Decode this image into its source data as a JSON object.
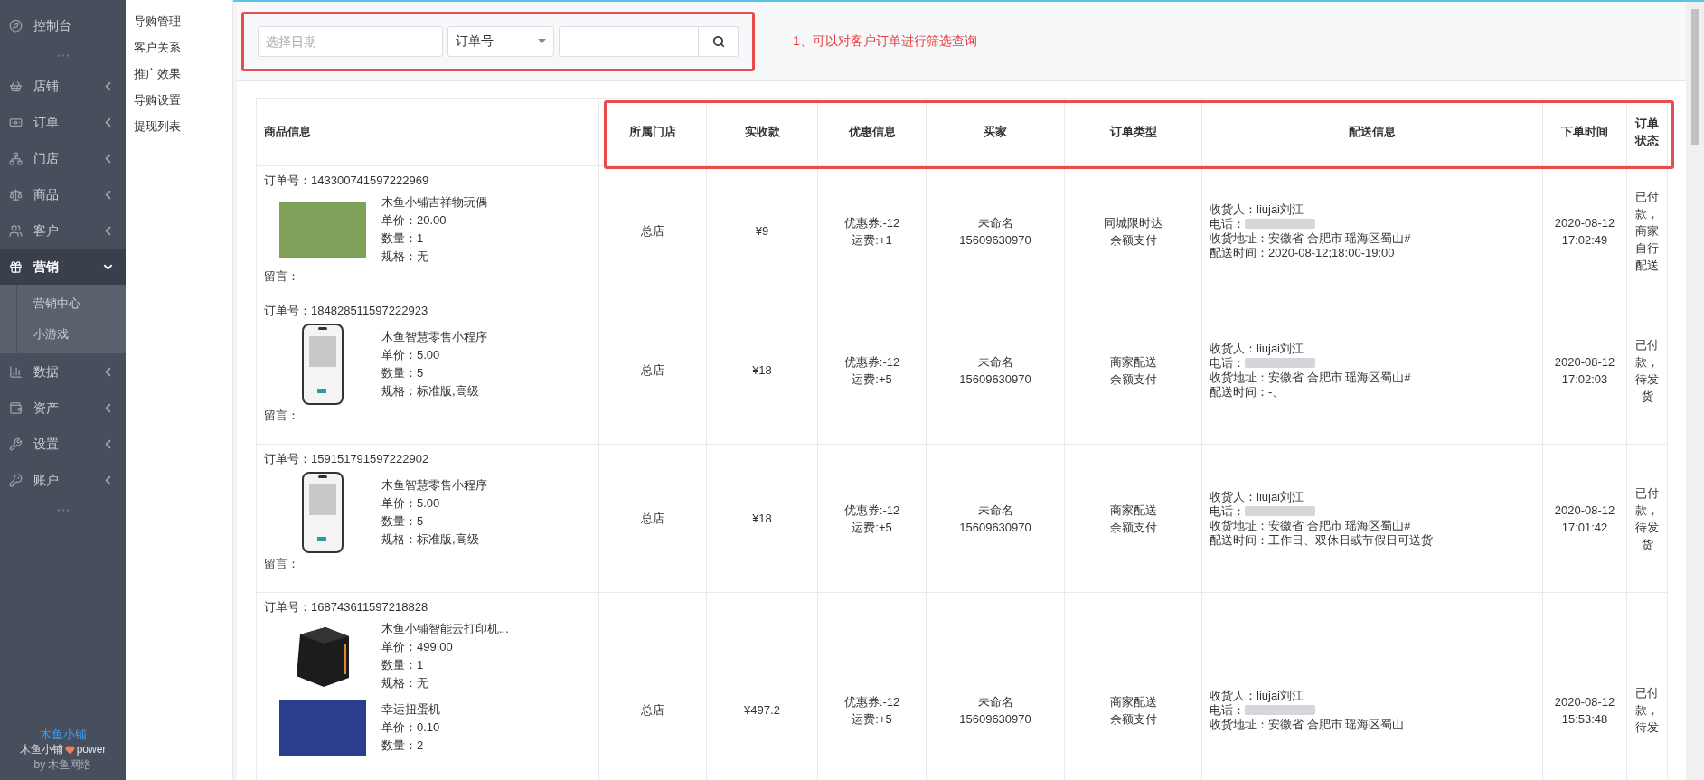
{
  "sidebar": {
    "items": [
      {
        "kind": "plain",
        "label": "控制台",
        "selected": false
      },
      {
        "kind": "separator"
      },
      {
        "kind": "group",
        "label": "店铺",
        "selected": false,
        "expanded": false
      },
      {
        "kind": "group",
        "label": "订单",
        "selected": false,
        "expanded": false
      },
      {
        "kind": "group",
        "label": "门店",
        "selected": false,
        "expanded": false
      },
      {
        "kind": "group",
        "label": "商品",
        "selected": false,
        "expanded": false
      },
      {
        "kind": "group",
        "label": "客户",
        "selected": false,
        "expanded": false
      },
      {
        "kind": "group",
        "label": "营销",
        "selected": true,
        "expanded": true,
        "children": [
          {
            "label": "营销中心",
            "selected": false
          },
          {
            "label": "小游戏",
            "selected": false
          }
        ]
      },
      {
        "kind": "group",
        "label": "数据",
        "selected": false,
        "expanded": false
      },
      {
        "kind": "group",
        "label": "资产",
        "selected": false,
        "expanded": false
      },
      {
        "kind": "group",
        "label": "设置",
        "selected": false,
        "expanded": false
      },
      {
        "kind": "group",
        "label": "账户",
        "selected": false,
        "expanded": false
      },
      {
        "kind": "separator"
      }
    ],
    "footer": {
      "brand": "木鱼小铺",
      "credit_prefix": "木鱼小铺",
      "credit_suffix": "power",
      "byline": "by 木鱼网络"
    }
  },
  "subnav": {
    "items": [
      {
        "label": "导购管理",
        "selected": false
      },
      {
        "label": "客户关系",
        "selected": false
      },
      {
        "label": "推广效果",
        "selected": false
      },
      {
        "label": "导购设置",
        "selected": false
      },
      {
        "label": "提现列表",
        "selected": false
      }
    ]
  },
  "filter": {
    "date": {
      "placeholder": "选择日期"
    },
    "field_select": {
      "value": "订单号"
    },
    "annotation": "1、可以对客户订单进行筛选查询"
  },
  "table": {
    "columns": [
      "商品信息",
      "所属门店",
      "实收款",
      "优惠信息",
      "买家",
      "订单类型",
      "配送信息",
      "下单时间",
      "订单状态"
    ],
    "rows": [
      {
        "order_no": "订单号：143300741597222969",
        "products": [
          {
            "kind": "photo",
            "name": "木鱼小铺吉祥物玩偶",
            "lines": [
              "单价：20.00",
              "数量：1",
              "规格：无"
            ]
          }
        ],
        "note": "留言：",
        "store": "总店",
        "amount": "¥9",
        "discount": [
          "优惠券:-12",
          "运费:+1"
        ],
        "buyer": [
          "未命名",
          "15609630970"
        ],
        "order_type": [
          "同城限时达",
          "余额支付"
        ],
        "delivery": {
          "recipient": "收货人：liujai刘江",
          "phone": "电话：",
          "address": "收货地址：安徽省 合肥市 瑶海区蜀山#",
          "time": "配送时间：2020-08-12;18:00-19:00"
        },
        "created": [
          "2020-08-12",
          "17:02:49"
        ],
        "status": "已付款，商家自行配送"
      },
      {
        "order_no": "订单号：184828511597222923",
        "products": [
          {
            "kind": "phone",
            "name": "木鱼智慧零售小程序",
            "lines": [
              "单价：5.00",
              "数量：5",
              "规格：标准版,高级"
            ]
          }
        ],
        "note": "留言：",
        "store": "总店",
        "amount": "¥18",
        "discount": [
          "优惠券:-12",
          "运费:+5"
        ],
        "buyer": [
          "未命名",
          "15609630970"
        ],
        "order_type": [
          "商家配送",
          "余额支付"
        ],
        "delivery": {
          "recipient": "收货人：liujai刘江",
          "phone": "电话：",
          "address": "收货地址：安徽省 合肥市 瑶海区蜀山#",
          "time": "配送时间：-、"
        },
        "created": [
          "2020-08-12",
          "17:02:03"
        ],
        "status": "已付款，待发货"
      },
      {
        "order_no": "订单号：159151791597222902",
        "products": [
          {
            "kind": "phone",
            "name": "木鱼智慧零售小程序",
            "lines": [
              "单价：5.00",
              "数量：5",
              "规格：标准版,高级"
            ]
          }
        ],
        "note": "留言：",
        "store": "总店",
        "amount": "¥18",
        "discount": [
          "优惠券:-12",
          "运费:+5"
        ],
        "buyer": [
          "未命名",
          "15609630970"
        ],
        "order_type": [
          "商家配送",
          "余额支付"
        ],
        "delivery": {
          "recipient": "收货人：liujai刘江",
          "phone": "电话：",
          "address": "收货地址：安徽省 合肥市 瑶海区蜀山#",
          "time": "配送时间：工作日、双休日或节假日可送货"
        },
        "created": [
          "2020-08-12",
          "17:01:42"
        ],
        "status": "已付款，待发货"
      },
      {
        "order_no": "订单号：168743611597218828",
        "products": [
          {
            "kind": "printer",
            "name": "木鱼小铺智能云打印机...",
            "lines": [
              "单价：499.00",
              "数量：1",
              "规格：无"
            ]
          },
          {
            "kind": "poster",
            "name": "幸运扭蛋机",
            "lines": [
              "单价：0.10",
              "数量：2"
            ]
          }
        ],
        "store": "总店",
        "amount": "¥497.2",
        "discount": [
          "优惠券:-12",
          "运费:+5"
        ],
        "buyer": [
          "未命名",
          "15609630970"
        ],
        "order_type": [
          "商家配送",
          "余额支付"
        ],
        "delivery": {
          "recipient": "收货人：liujai刘江",
          "phone": "电话：",
          "address": "收货地址：安徽省 合肥市 瑶海区蜀山"
        },
        "created": [
          "2020-08-12",
          "15:53:48"
        ],
        "status": "已付款，待发"
      }
    ]
  }
}
